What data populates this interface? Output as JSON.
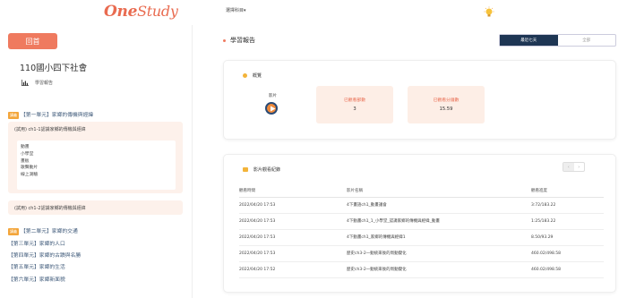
{
  "header": {
    "logo_prefix": "One",
    "logo_suffix": "Study",
    "subject_select": "選擇科目▾"
  },
  "sidebar": {
    "back_button": "回首",
    "course_title": "110國小四下社會",
    "report_link": "學習報告",
    "tag_label": "講義",
    "units": [
      "【第一單元】家鄉的傳機與經緯",
      "【第二單元】家鄉的交通",
      "【第三單元】家鄉的人口",
      "【第四單元】家鄉的古蹟與名勝",
      "【第五單元】家鄉的生活",
      "【第六單元】家鄉新面貌"
    ],
    "lesson1": {
      "title": "(試用) ch1-1認識家鄉的傳機與經緯",
      "items": [
        "動畫",
        "小學堂",
        "畫板",
        "歌聲動片",
        "線上測驗"
      ]
    },
    "lesson2": {
      "title": "(試用) ch1-2認識家鄉的傳機與經緯"
    }
  },
  "main": {
    "page_title": "學習報告",
    "toggle": {
      "active": "最近七天",
      "inactive": "全部"
    },
    "overview": {
      "title": "概覽",
      "video_label": "影片",
      "stats": [
        {
          "label": "已觀看部數",
          "value": "3"
        },
        {
          "label": "已觀看分鐘數",
          "value": "15.59"
        }
      ]
    },
    "history": {
      "title": "影片觀看紀錄",
      "pager_prev": "‹",
      "pager_next": "›",
      "columns": [
        "觀看時間",
        "影片名稱",
        "觀看進度"
      ],
      "rows": [
        [
          "2022/04/20 17:53",
          "4下畫語ch1_動畫議會",
          "3:72/183.22"
        ],
        [
          "2022/04/20 17:53",
          "4下動畫ch1_1_小學堂_認識家鄉的傳機與經緯_動畫",
          "1:25/183.22"
        ],
        [
          "2022/04/20 17:53",
          "4下動畫ch1_家鄉的傳機與經緯1",
          "8.50/93.29"
        ],
        [
          "2022/04/20 17:53",
          "歷史ch3-2一動統來後的周動變化",
          "460.02/498.58"
        ],
        [
          "2022/04/20 17:52",
          "歷史ch3-2一動統來後的周動變化",
          "460.02/498.58"
        ]
      ]
    }
  },
  "colors": {
    "accent": "#ef7a5f",
    "navy": "#1e3654",
    "tag": "#f3a53a",
    "stat_bg": "#fdeee6"
  }
}
